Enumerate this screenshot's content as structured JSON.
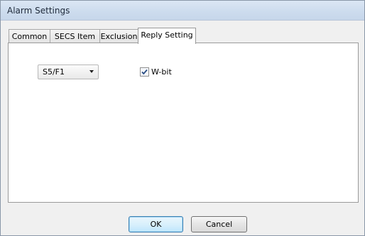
{
  "window": {
    "title": "Alarm Settings"
  },
  "tabs": [
    {
      "label": "Common",
      "active": false
    },
    {
      "label": "SECS Item",
      "active": false
    },
    {
      "label": "Exclusion",
      "active": false
    },
    {
      "label": "Reply Setting",
      "active": true
    }
  ],
  "reply_setting": {
    "message_select": {
      "value": "S5/F1"
    },
    "wbit_checkbox": {
      "label": "W-bit",
      "checked": true
    }
  },
  "buttons": {
    "ok": "OK",
    "cancel": "Cancel"
  }
}
